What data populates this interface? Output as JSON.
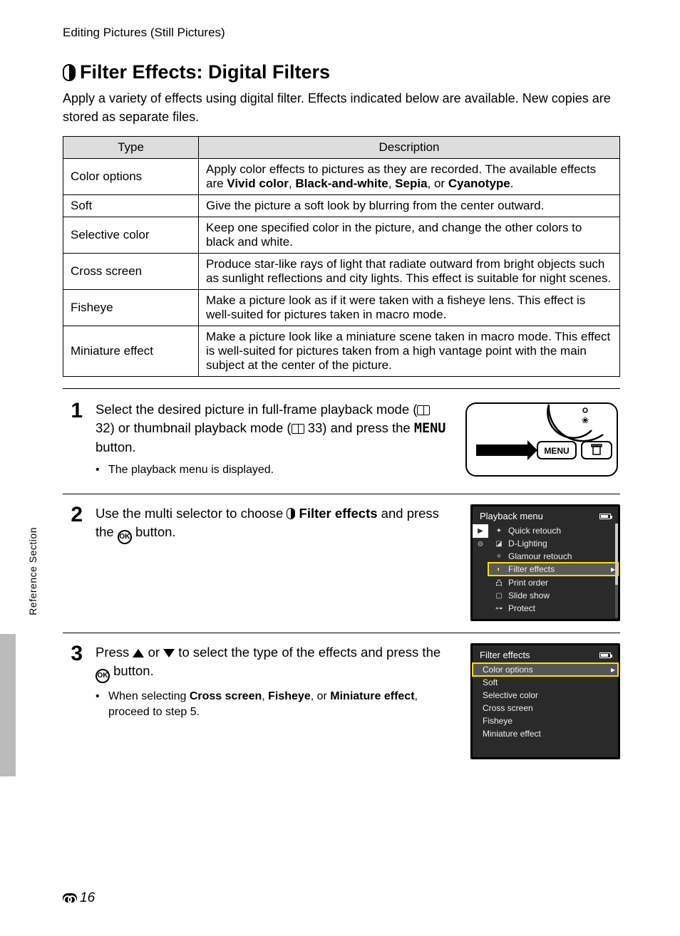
{
  "breadcrumb": "Editing Pictures (Still Pictures)",
  "heading": {
    "title": "Filter Effects: Digital Filters"
  },
  "intro": "Apply a variety of effects using digital filter. Effects indicated below are available. New copies are stored as separate files.",
  "table": {
    "headers": {
      "type": "Type",
      "description": "Description"
    },
    "rows": [
      {
        "type": "Color options",
        "desc_prefix": "Apply color effects to pictures as they are recorded. The available effects are ",
        "bold1": "Vivid color",
        "sep1": ", ",
        "bold2": "Black-and-white",
        "sep2": ", ",
        "bold3": "Sepia",
        "sep3": ", or ",
        "bold4": "Cyanotype",
        "suffix": "."
      },
      {
        "type": "Soft",
        "desc": "Give the picture a soft look by blurring from the center outward."
      },
      {
        "type": "Selective color",
        "desc": "Keep one specified color in the picture, and change the other colors to black and white."
      },
      {
        "type": "Cross screen",
        "desc": "Produce star-like rays of light that radiate outward from bright objects such as sunlight reflections and city lights. This effect is suitable for night scenes."
      },
      {
        "type": "Fisheye",
        "desc": "Make a picture look as if it were taken with a fisheye lens. This effect is well-suited for pictures taken in macro mode."
      },
      {
        "type": "Miniature effect",
        "desc": "Make a picture look like a miniature scene taken in macro mode. This effect is well-suited for pictures taken from a high vantage point with the main subject at the center of the picture."
      }
    ]
  },
  "steps": {
    "s1": {
      "num": "1",
      "t1": "Select the desired picture in full-frame playback mode (",
      "ref1": " 32) or thumbnail playback mode (",
      "ref2": " 33) and press the ",
      "menu": "MENU",
      "t2": " button.",
      "bullet": "The playback menu is displayed.",
      "diagram_label": "MENU"
    },
    "s2": {
      "num": "2",
      "t1": "Use the multi selector to choose ",
      "bold1": "Filter effects",
      "t2": " and press the ",
      "ok": "OK",
      "t3": " button.",
      "lcd_title": "Playback menu",
      "items": [
        {
          "icon": "✦",
          "label": "Quick retouch"
        },
        {
          "icon": "◪",
          "label": "D-Lighting"
        },
        {
          "icon": "✧",
          "label": "Glamour retouch"
        },
        {
          "icon": "◐",
          "label": "Filter effects",
          "selected": true
        },
        {
          "icon": "凸",
          "label": "Print order"
        },
        {
          "icon": "▢",
          "label": "Slide show"
        },
        {
          "icon": "⊶",
          "label": "Protect"
        }
      ],
      "sidebar_top": "▶",
      "sidebar_mid": "⚙"
    },
    "s3": {
      "num": "3",
      "t1": "Press ",
      "t2": " or ",
      "t3": " to select the type of the effects and press the ",
      "ok": "OK",
      "t4": " button.",
      "bullet_pre": "When selecting ",
      "b1": "Cross screen",
      "sep1": ", ",
      "b2": "Fisheye",
      "sep2": ", or ",
      "b3": "Miniature effect",
      "bullet_post": ", proceed to step 5.",
      "lcd_title": "Filter effects",
      "items": [
        {
          "label": "Color options",
          "selected": true
        },
        {
          "label": "Soft"
        },
        {
          "label": "Selective color"
        },
        {
          "label": "Cross screen"
        },
        {
          "label": "Fisheye"
        },
        {
          "label": "Miniature effect"
        }
      ]
    }
  },
  "side_tab": "Reference Section",
  "page_number": "16"
}
